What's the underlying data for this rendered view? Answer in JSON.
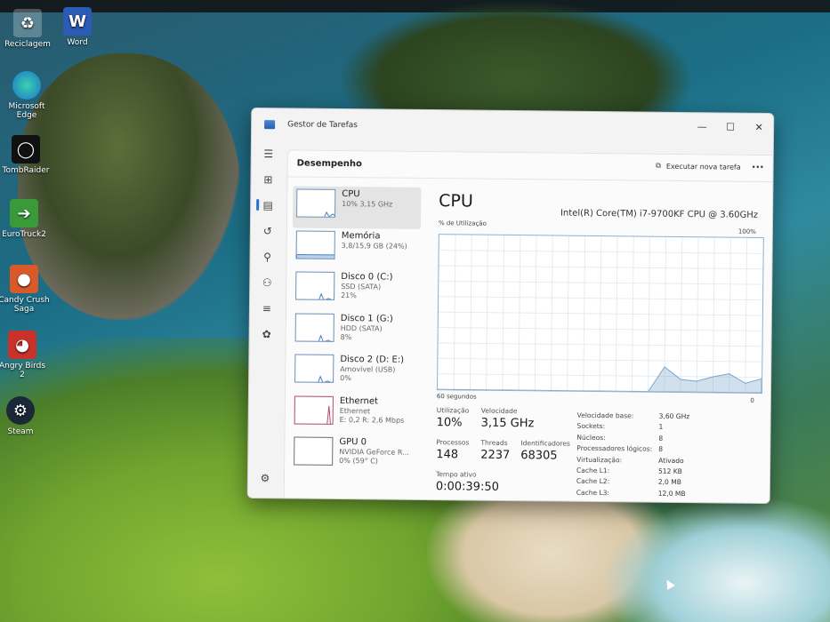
{
  "desktop": {
    "icons": [
      {
        "label": "Reciclagem",
        "icon": "recycle-bin-icon"
      },
      {
        "label": "Word",
        "icon": "word-icon"
      },
      {
        "label": "Microsoft Edge",
        "icon": "edge-icon"
      },
      {
        "label": "TombRaider",
        "icon": "tombraider-icon"
      },
      {
        "label": "EuroTruck2",
        "icon": "eurotruck-icon"
      },
      {
        "label": "Candy Crush Saga",
        "icon": "candy-crush-icon"
      },
      {
        "label": "Angry Birds 2",
        "icon": "angry-birds-icon"
      },
      {
        "label": "Steam",
        "icon": "steam-icon"
      }
    ]
  },
  "window": {
    "title": "Gestor de Tarefas",
    "controls": {
      "minimize": "—",
      "maximize": "☐",
      "close": "✕"
    }
  },
  "nav": {
    "items": [
      "menu-icon",
      "processes-icon",
      "performance-icon",
      "history-icon",
      "startup-icon",
      "users-icon",
      "details-icon",
      "services-icon"
    ],
    "active": 2,
    "settings": "settings-icon"
  },
  "header": {
    "title": "Desempenho",
    "run_task": "Executar nova tarefa",
    "more": "···"
  },
  "perf_list": [
    {
      "name": "CPU",
      "sub1": "10% 3,15 GHz",
      "sub2": "",
      "kind": "cpu"
    },
    {
      "name": "Memória",
      "sub1": "3,8/15,9 GB (24%)",
      "sub2": "",
      "kind": "mem"
    },
    {
      "name": "Disco 0 (C:)",
      "sub1": "SSD (SATA)",
      "sub2": "21%",
      "kind": "disk"
    },
    {
      "name": "Disco 1 (G:)",
      "sub1": "HDD (SATA)",
      "sub2": "8%",
      "kind": "disk"
    },
    {
      "name": "Disco 2 (D: E:)",
      "sub1": "Amovível (USB)",
      "sub2": "0%",
      "kind": "disk"
    },
    {
      "name": "Ethernet",
      "sub1": "Ethernet",
      "sub2": "E: 0,2 R: 2,6 Mbps",
      "kind": "net"
    },
    {
      "name": "GPU 0",
      "sub1": "NVIDIA GeForce R...",
      "sub2": "0% (59° C)",
      "kind": "gpu"
    }
  ],
  "detail": {
    "title": "CPU",
    "model": "Intel(R) Core(TM) i7-9700KF CPU @ 3.60GHz",
    "util_label": "% de Utilização",
    "max_label": "100%",
    "x_left": "60 segundos",
    "x_right": "0"
  },
  "chart_data": {
    "type": "area",
    "x": [
      60,
      57,
      54,
      51,
      48,
      45,
      42,
      39,
      36,
      33,
      30,
      27,
      24,
      21,
      18,
      15,
      12,
      9,
      6,
      3,
      0
    ],
    "values": [
      0,
      0,
      0,
      0,
      0,
      0,
      0,
      0,
      0,
      0,
      0,
      0,
      0,
      0,
      16,
      8,
      7,
      10,
      12,
      6,
      9
    ],
    "ylim": [
      0,
      100
    ],
    "xlabel": "60 segundos",
    "ylabel": "% de Utilização",
    "grid": true,
    "color": "#7aa6cc"
  },
  "stats": {
    "utilizacao_lbl": "Utilização",
    "utilizacao_val": "10%",
    "velocidade_lbl": "Velocidade",
    "velocidade_val": "3,15 GHz",
    "processos_lbl": "Processos",
    "processos_val": "148",
    "threads_lbl": "Threads",
    "threads_val": "2237",
    "identificadores_lbl": "Identificadores",
    "identificadores_val": "68305",
    "tempo_lbl": "Tempo ativo",
    "tempo_val": "0:00:39:50"
  },
  "specs": [
    {
      "k": "Velocidade base:",
      "v": "3,60 GHz"
    },
    {
      "k": "Sockets:",
      "v": "1"
    },
    {
      "k": "Núcleos:",
      "v": "8"
    },
    {
      "k": "Processadores lógicos:",
      "v": "8"
    },
    {
      "k": "Virtualização:",
      "v": "Ativado"
    },
    {
      "k": "Cache L1:",
      "v": "512 KB"
    },
    {
      "k": "Cache L2:",
      "v": "2,0 MB"
    },
    {
      "k": "Cache L3:",
      "v": "12,0 MB"
    }
  ]
}
